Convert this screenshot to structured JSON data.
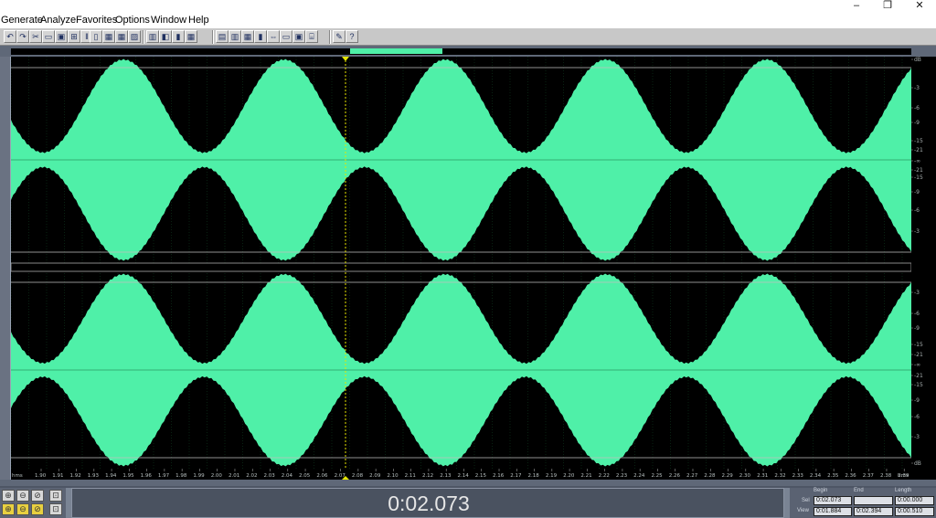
{
  "window": {
    "minimize": "–",
    "restore": "❐",
    "close": "✕"
  },
  "menu": [
    "Generate",
    "Analyze",
    "Favorites",
    "Options",
    "Window",
    "Help"
  ],
  "toolbar_icons": [
    "undo-icon",
    "redo-icon",
    "cut-icon",
    "copy-icon",
    "paste-icon",
    "mix-paste-icon",
    "trim-icon",
    "silence-icon",
    "save-icon",
    "save-all-icon",
    "export-icon",
    "spectral-icon",
    "bars-icon",
    "meter-icon",
    "grid-icon",
    "waveform-view-icon",
    "spectral-view-icon",
    "stereo-view-icon",
    "marker-icon",
    "loop-icon",
    "snap-icon",
    "cue-icon",
    "play-list-icon",
    "settings-icon",
    "help-icon"
  ],
  "db_scale": {
    "top": [
      "dB",
      "-3",
      "-6",
      "-9",
      "-15",
      "-21",
      "-∞",
      "-21",
      "-15",
      "-9",
      "-6",
      "-3"
    ],
    "bottom": [
      "-3",
      "-6",
      "-9",
      "-15",
      "-21",
      "-∞",
      "-21",
      "-15",
      "-9",
      "-6",
      "-3",
      "dB"
    ]
  },
  "time_ruler": {
    "start_label": "hms",
    "end_label": "hms",
    "ticks": [
      "1.90",
      "1.91",
      "1.92",
      "1.93",
      "1.94",
      "1.95",
      "1.96",
      "1.97",
      "1.98",
      "1.99",
      "2.00",
      "2.01",
      "2.02",
      "2.03",
      "2.04",
      "2.05",
      "2.06",
      "2.07",
      "2.08",
      "2.09",
      "2.10",
      "2.11",
      "2.12",
      "2.13",
      "2.14",
      "2.15",
      "2.16",
      "2.17",
      "2.18",
      "2.19",
      "2.20",
      "2.21",
      "2.22",
      "2.23",
      "2.24",
      "2.25",
      "2.26",
      "2.27",
      "2.28",
      "2.29",
      "2.30",
      "2.31",
      "2.32",
      "2.33",
      "2.34",
      "2.35",
      "2.36",
      "2.37",
      "2.38",
      "2.39"
    ]
  },
  "waveform": {
    "color": "#4ff0a8",
    "background": "#000000",
    "cycles_visible": 5.6
  },
  "time_display": "0:02.073",
  "selection": {
    "headers": {
      "begin": "Begin",
      "end": "End",
      "length": "Length"
    },
    "sel_label": "Sel",
    "view_label": "View",
    "sel_begin": "0:02.073",
    "sel_end": "",
    "sel_length": "0:00.000",
    "view_begin": "0:01.884",
    "view_end": "0:02.394",
    "view_length": "0:00.510"
  },
  "zoom_buttons": [
    "zoom-in-full-icon",
    "zoom-out-full-icon",
    "zoom-out-icon",
    "zoom-fit-icon",
    "zoom-in-vertical-icon",
    "zoom-out-vertical-icon",
    "zoom-sel-icon",
    "zoom-reset-icon"
  ]
}
